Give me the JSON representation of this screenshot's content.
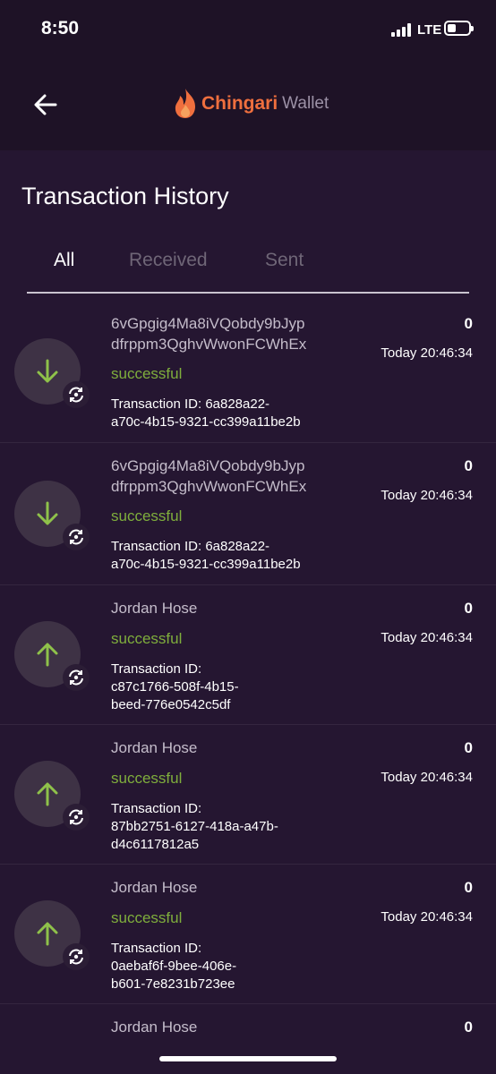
{
  "status_bar": {
    "time": "8:50",
    "network": "LTE"
  },
  "header": {
    "logo_brand": "Chingari",
    "logo_suffix": "Wallet"
  },
  "page": {
    "title": "Transaction History"
  },
  "tabs": [
    {
      "label": "All",
      "active": true
    },
    {
      "label": "Received",
      "active": false
    },
    {
      "label": "Sent",
      "active": false
    }
  ],
  "transactions": [
    {
      "direction": "received",
      "name": "6vGpgig4Ma8iVQobdy9bJypdfrppm3QghvWwonFCWhEx",
      "name_line1": "6vGpgig4Ma8iVQobdy9bJyp",
      "name_line2": "dfrppm3QghvWwonFCWhEx",
      "status": "successful",
      "id_label": "Transaction ID: 6a828a22-",
      "id_line2": "a70c-4b15-9321-cc399a11be2b",
      "amount": "0",
      "time": "Today 20:46:34"
    },
    {
      "direction": "received",
      "name": "6vGpgig4Ma8iVQobdy9bJypdfrppm3QghvWwonFCWhEx",
      "name_line1": "6vGpgig4Ma8iVQobdy9bJyp",
      "name_line2": "dfrppm3QghvWwonFCWhEx",
      "status": "successful",
      "id_label": "Transaction ID: 6a828a22-",
      "id_line2": "a70c-4b15-9321-cc399a11be2b",
      "amount": "0",
      "time": "Today 20:46:34"
    },
    {
      "direction": "sent",
      "name": "Jordan Hose",
      "status": "successful",
      "id_label": "Transaction ID:",
      "id_line2": "c87c1766-508f-4b15-",
      "id_line3": "beed-776e0542c5df",
      "amount": "0",
      "time": "Today 20:46:34"
    },
    {
      "direction": "sent",
      "name": "Jordan Hose",
      "status": "successful",
      "id_label": "Transaction ID:",
      "id_line2": "87bb2751-6127-418a-a47b-",
      "id_line3": "d4c6117812a5",
      "amount": "0",
      "time": "Today 20:46:34"
    },
    {
      "direction": "sent",
      "name": "Jordan Hose",
      "status": "successful",
      "id_label": "Transaction ID:",
      "id_line2": "0aebaf6f-9bee-406e-",
      "id_line3": "b601-7e8231b723ee",
      "amount": "0",
      "time": "Today 20:46:34"
    },
    {
      "direction": "sent",
      "name": "Jordan Hose",
      "amount": "0"
    }
  ],
  "colors": {
    "background": "#251631",
    "header": "#1e1226",
    "accent_green": "#7fae3c",
    "brand_orange": "#ef6f3e"
  },
  "icons": {
    "back": "arrow-left-icon",
    "received": "arrow-down-icon",
    "sent": "arrow-up-icon",
    "badge": "refresh-coin-icon",
    "logo": "flame-icon"
  }
}
